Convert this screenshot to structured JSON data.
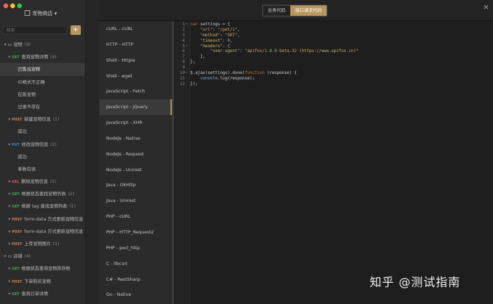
{
  "project": {
    "name": "宠物商店",
    "search_placeholder": "搜索",
    "add_label": "+"
  },
  "tree": [
    {
      "indent": 6,
      "folder": true,
      "label": "宠物",
      "count": "(9)"
    },
    {
      "indent": 12,
      "method": "GET",
      "label": "查询宠物详情",
      "count": "(4)"
    },
    {
      "indent": 26,
      "label": "已售出宠物",
      "selected": true
    },
    {
      "indent": 26,
      "label": "ID格式不正确"
    },
    {
      "indent": 26,
      "label": "在售宠物"
    },
    {
      "indent": 26,
      "label": "记录不存在"
    },
    {
      "indent": 12,
      "method": "POST",
      "label": "新建宠物信息",
      "count": "(1)"
    },
    {
      "indent": 26,
      "label": "成功"
    },
    {
      "indent": 12,
      "method": "PUT",
      "label": "修改宠物信息",
      "count": "(2)"
    },
    {
      "indent": 26,
      "label": "成功"
    },
    {
      "indent": 26,
      "label": "参数有误"
    },
    {
      "indent": 12,
      "method": "DEL",
      "label": "删除宠物信息",
      "count": "(1)"
    },
    {
      "indent": 12,
      "method": "GET",
      "label": "根据状态查找宠物列表",
      "count": "(2)"
    },
    {
      "indent": 12,
      "method": "GET",
      "label": "根据 tag 查找宠物列表",
      "count": "(1)"
    },
    {
      "indent": 12,
      "method": "POST",
      "label": "form-data 方式更新宠物信息"
    },
    {
      "indent": 12,
      "method": "POST",
      "label": "form-data 方式更新宠物信息"
    },
    {
      "indent": 12,
      "method": "POST",
      "label": "上传宠物图片",
      "count": "(1)"
    },
    {
      "indent": 6,
      "folder": true,
      "label": "店铺",
      "count": "(4)"
    },
    {
      "indent": 12,
      "method": "GET",
      "label": "根据状态查询宠物库存数"
    },
    {
      "indent": 12,
      "method": "POST",
      "label": "下单购买宠物"
    },
    {
      "indent": 12,
      "method": "GET",
      "label": "查询订单详情"
    }
  ],
  "modal": {
    "tab_business": "业务代码",
    "tab_request": "接口请求代码",
    "close": "✕"
  },
  "languages": [
    "cURL - cURL",
    "HTTP - HTTP",
    "Shell - Httpie",
    "Shell - wget",
    "JavaScript - Fetch",
    "JavaScript - jQuery",
    "JavaScript - XHR",
    "NodeJs - Native",
    "NodeJs - Request",
    "NodeJs - Unirest",
    "Java - OkHttp",
    "Java - Unirest",
    "PHP - cURL",
    "PHP - HTTP_Request2",
    "PHP - pecl_http",
    "C - libcurl",
    "C# - RestSharp",
    "Go - Native"
  ],
  "active_language": "JavaScript - jQuery",
  "code_lines": [
    "var settings = {",
    "    \"url\": \"/pet/1\",",
    "    \"method\": \"GET\",",
    "    \"timeout\": 0,",
    "    \"headers\": {",
    "        \"user-agent\": \"apifox/1.0.0-beta.32 (https://www.apifox.cn)\"",
    "    },",
    "};",
    "",
    "$.ajax(settings).done(function (response) {",
    "    console.log(response);",
    "});"
  ],
  "watermark": "知乎 @测试指南"
}
